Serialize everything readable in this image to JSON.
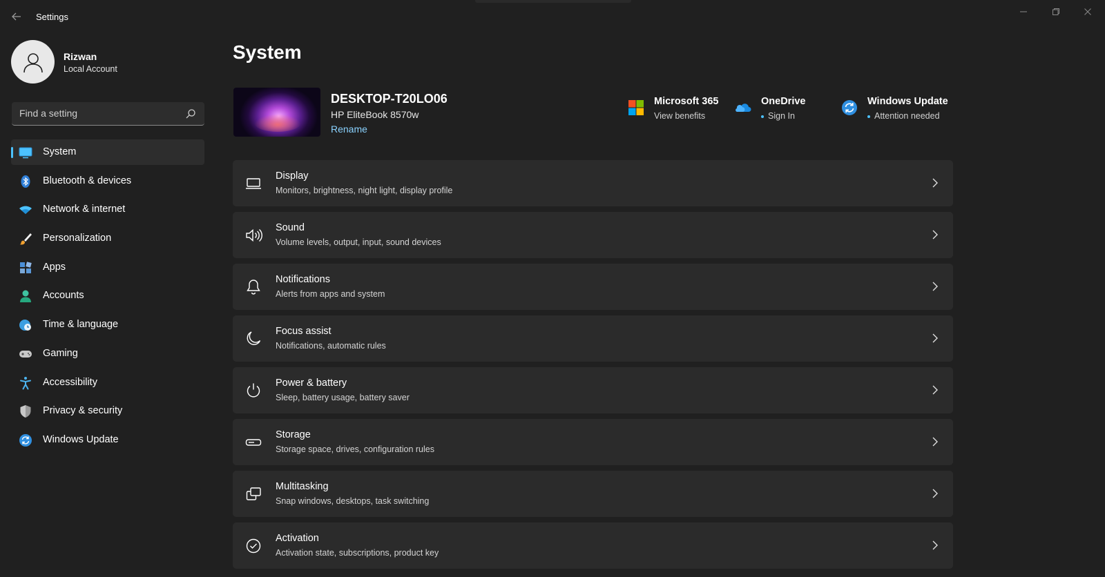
{
  "window": {
    "title": "Settings"
  },
  "user": {
    "name": "Rizwan",
    "account_type": "Local Account"
  },
  "search": {
    "placeholder": "Find a setting"
  },
  "sidebar": {
    "items": [
      {
        "label": "System",
        "icon": "system-icon",
        "active": true
      },
      {
        "label": "Bluetooth & devices",
        "icon": "bluetooth-icon"
      },
      {
        "label": "Network & internet",
        "icon": "wifi-icon"
      },
      {
        "label": "Personalization",
        "icon": "brush-icon"
      },
      {
        "label": "Apps",
        "icon": "apps-icon"
      },
      {
        "label": "Accounts",
        "icon": "accounts-icon"
      },
      {
        "label": "Time & language",
        "icon": "globe-clock-icon"
      },
      {
        "label": "Gaming",
        "icon": "gamepad-icon"
      },
      {
        "label": "Accessibility",
        "icon": "accessibility-icon"
      },
      {
        "label": "Privacy & security",
        "icon": "shield-icon"
      },
      {
        "label": "Windows Update",
        "icon": "update-icon"
      }
    ]
  },
  "main": {
    "title": "System",
    "device": {
      "name": "DESKTOP-T20LO06",
      "model": "HP EliteBook 8570w",
      "rename_label": "Rename"
    },
    "quick_links": [
      {
        "title": "Microsoft 365",
        "subtitle": "View benefits",
        "icon": "microsoft-365-icon"
      },
      {
        "title": "OneDrive",
        "subtitle": "Sign In",
        "icon": "onedrive-icon"
      },
      {
        "title": "Windows Update",
        "subtitle": "Attention needed",
        "icon": "windows-update-icon"
      }
    ],
    "cards": [
      {
        "title": "Display",
        "subtitle": "Monitors, brightness, night light, display profile",
        "icon": "display-icon"
      },
      {
        "title": "Sound",
        "subtitle": "Volume levels, output, input, sound devices",
        "icon": "speaker-icon"
      },
      {
        "title": "Notifications",
        "subtitle": "Alerts from apps and system",
        "icon": "bell-icon"
      },
      {
        "title": "Focus assist",
        "subtitle": "Notifications, automatic rules",
        "icon": "moon-icon"
      },
      {
        "title": "Power & battery",
        "subtitle": "Sleep, battery usage, battery saver",
        "icon": "power-icon"
      },
      {
        "title": "Storage",
        "subtitle": "Storage space, drives, configuration rules",
        "icon": "storage-icon"
      },
      {
        "title": "Multitasking",
        "subtitle": "Snap windows, desktops, task switching",
        "icon": "multitasking-icon"
      },
      {
        "title": "Activation",
        "subtitle": "Activation state, subscriptions, product key",
        "icon": "check-circle-icon"
      }
    ]
  },
  "colors": {
    "background": "#202020",
    "card": "#2b2b2b",
    "accent": "#4cc2ff",
    "link": "#8ad2ff"
  }
}
